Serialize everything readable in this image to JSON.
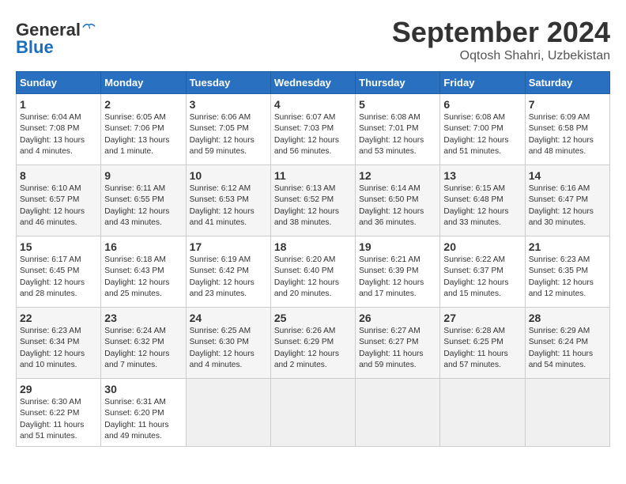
{
  "header": {
    "logo_general": "General",
    "logo_blue": "Blue",
    "month": "September 2024",
    "location": "Oqtosh Shahri, Uzbekistan"
  },
  "days_of_week": [
    "Sunday",
    "Monday",
    "Tuesday",
    "Wednesday",
    "Thursday",
    "Friday",
    "Saturday"
  ],
  "weeks": [
    [
      {
        "day": "1",
        "sunrise": "6:04 AM",
        "sunset": "7:08 PM",
        "daylight": "13 hours and 4 minutes."
      },
      {
        "day": "2",
        "sunrise": "6:05 AM",
        "sunset": "7:06 PM",
        "daylight": "13 hours and 1 minute."
      },
      {
        "day": "3",
        "sunrise": "6:06 AM",
        "sunset": "7:05 PM",
        "daylight": "12 hours and 59 minutes."
      },
      {
        "day": "4",
        "sunrise": "6:07 AM",
        "sunset": "7:03 PM",
        "daylight": "12 hours and 56 minutes."
      },
      {
        "day": "5",
        "sunrise": "6:08 AM",
        "sunset": "7:01 PM",
        "daylight": "12 hours and 53 minutes."
      },
      {
        "day": "6",
        "sunrise": "6:08 AM",
        "sunset": "7:00 PM",
        "daylight": "12 hours and 51 minutes."
      },
      {
        "day": "7",
        "sunrise": "6:09 AM",
        "sunset": "6:58 PM",
        "daylight": "12 hours and 48 minutes."
      }
    ],
    [
      {
        "day": "8",
        "sunrise": "6:10 AM",
        "sunset": "6:57 PM",
        "daylight": "12 hours and 46 minutes."
      },
      {
        "day": "9",
        "sunrise": "6:11 AM",
        "sunset": "6:55 PM",
        "daylight": "12 hours and 43 minutes."
      },
      {
        "day": "10",
        "sunrise": "6:12 AM",
        "sunset": "6:53 PM",
        "daylight": "12 hours and 41 minutes."
      },
      {
        "day": "11",
        "sunrise": "6:13 AM",
        "sunset": "6:52 PM",
        "daylight": "12 hours and 38 minutes."
      },
      {
        "day": "12",
        "sunrise": "6:14 AM",
        "sunset": "6:50 PM",
        "daylight": "12 hours and 36 minutes."
      },
      {
        "day": "13",
        "sunrise": "6:15 AM",
        "sunset": "6:48 PM",
        "daylight": "12 hours and 33 minutes."
      },
      {
        "day": "14",
        "sunrise": "6:16 AM",
        "sunset": "6:47 PM",
        "daylight": "12 hours and 30 minutes."
      }
    ],
    [
      {
        "day": "15",
        "sunrise": "6:17 AM",
        "sunset": "6:45 PM",
        "daylight": "12 hours and 28 minutes."
      },
      {
        "day": "16",
        "sunrise": "6:18 AM",
        "sunset": "6:43 PM",
        "daylight": "12 hours and 25 minutes."
      },
      {
        "day": "17",
        "sunrise": "6:19 AM",
        "sunset": "6:42 PM",
        "daylight": "12 hours and 23 minutes."
      },
      {
        "day": "18",
        "sunrise": "6:20 AM",
        "sunset": "6:40 PM",
        "daylight": "12 hours and 20 minutes."
      },
      {
        "day": "19",
        "sunrise": "6:21 AM",
        "sunset": "6:39 PM",
        "daylight": "12 hours and 17 minutes."
      },
      {
        "day": "20",
        "sunrise": "6:22 AM",
        "sunset": "6:37 PM",
        "daylight": "12 hours and 15 minutes."
      },
      {
        "day": "21",
        "sunrise": "6:23 AM",
        "sunset": "6:35 PM",
        "daylight": "12 hours and 12 minutes."
      }
    ],
    [
      {
        "day": "22",
        "sunrise": "6:23 AM",
        "sunset": "6:34 PM",
        "daylight": "12 hours and 10 minutes."
      },
      {
        "day": "23",
        "sunrise": "6:24 AM",
        "sunset": "6:32 PM",
        "daylight": "12 hours and 7 minutes."
      },
      {
        "day": "24",
        "sunrise": "6:25 AM",
        "sunset": "6:30 PM",
        "daylight": "12 hours and 4 minutes."
      },
      {
        "day": "25",
        "sunrise": "6:26 AM",
        "sunset": "6:29 PM",
        "daylight": "12 hours and 2 minutes."
      },
      {
        "day": "26",
        "sunrise": "6:27 AM",
        "sunset": "6:27 PM",
        "daylight": "11 hours and 59 minutes."
      },
      {
        "day": "27",
        "sunrise": "6:28 AM",
        "sunset": "6:25 PM",
        "daylight": "11 hours and 57 minutes."
      },
      {
        "day": "28",
        "sunrise": "6:29 AM",
        "sunset": "6:24 PM",
        "daylight": "11 hours and 54 minutes."
      }
    ],
    [
      {
        "day": "29",
        "sunrise": "6:30 AM",
        "sunset": "6:22 PM",
        "daylight": "11 hours and 51 minutes."
      },
      {
        "day": "30",
        "sunrise": "6:31 AM",
        "sunset": "6:20 PM",
        "daylight": "11 hours and 49 minutes."
      },
      null,
      null,
      null,
      null,
      null
    ]
  ]
}
